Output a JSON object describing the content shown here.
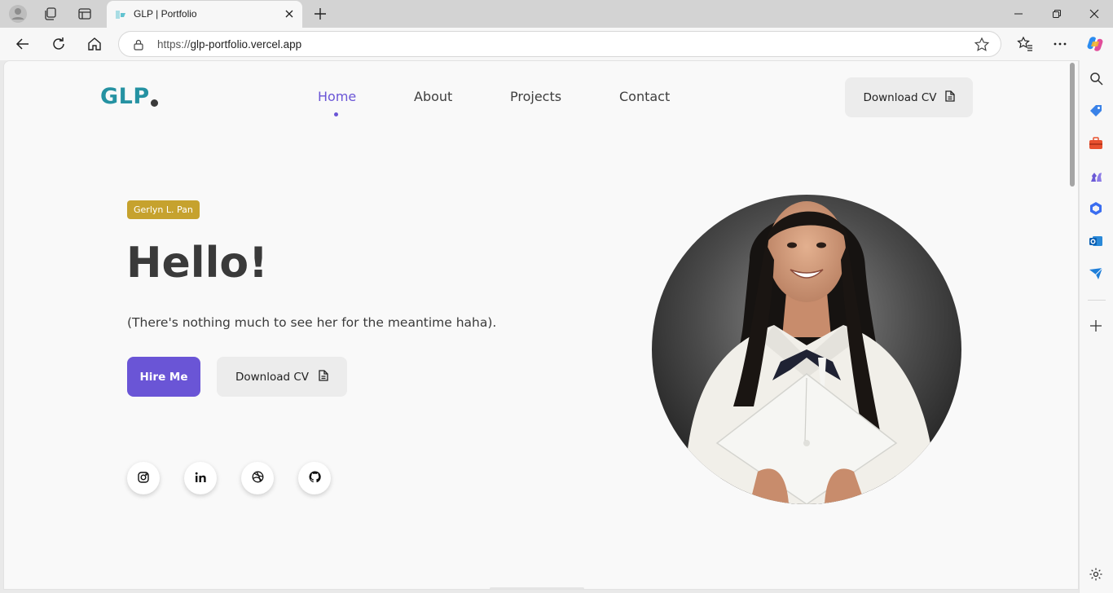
{
  "browser": {
    "tab_title": "GLP | Portfolio",
    "url_prefix": "https://",
    "url_host": "glp-portfolio.vercel.app"
  },
  "nav": {
    "logo": "GLP",
    "items": [
      {
        "label": "Home",
        "active": true
      },
      {
        "label": "About",
        "active": false
      },
      {
        "label": "Projects",
        "active": false
      },
      {
        "label": "Contact",
        "active": false
      }
    ],
    "download_cv": "Download CV"
  },
  "hero": {
    "name_badge": "Gerlyn L. Pan",
    "greeting": "Hello!",
    "tagline": "(There's nothing much to see her for the meantime haha).",
    "hire_button": "Hire Me",
    "download_button": "Download CV"
  },
  "social": [
    "instagram-icon",
    "linkedin-icon",
    "dribbble-icon",
    "github-icon"
  ],
  "colors": {
    "accent": "#6a55d6",
    "logo": "#2592a2",
    "badge": "#c6a22e",
    "text": "#3a3a3a"
  }
}
